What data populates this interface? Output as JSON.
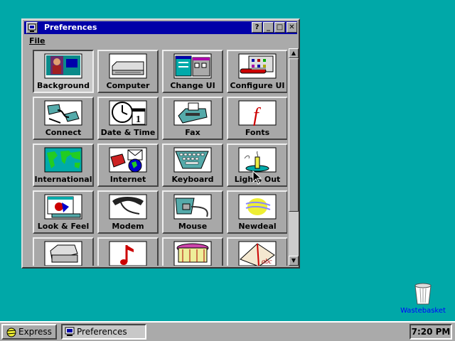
{
  "window": {
    "title": "Preferences",
    "controls": {
      "help": "?",
      "minimize": "_",
      "maximize": "□",
      "close": "✕"
    },
    "menu": {
      "file": "File"
    }
  },
  "tiles": [
    {
      "label": "Background",
      "icon": "background-icon"
    },
    {
      "label": "Computer",
      "icon": "computer-icon"
    },
    {
      "label": "Change UI",
      "icon": "change-ui-icon"
    },
    {
      "label": "Configure UI",
      "icon": "configure-ui-icon"
    },
    {
      "label": "Connect",
      "icon": "connect-icon"
    },
    {
      "label": "Date & Time",
      "icon": "date-time-icon"
    },
    {
      "label": "Fax",
      "icon": "fax-icon"
    },
    {
      "label": "Fonts",
      "icon": "fonts-icon"
    },
    {
      "label": "International",
      "icon": "world-map-icon"
    },
    {
      "label": "Internet",
      "icon": "internet-icon"
    },
    {
      "label": "Keyboard",
      "icon": "keyboard-icon"
    },
    {
      "label": "Lights Out",
      "icon": "candle-icon"
    },
    {
      "label": "Look & Feel",
      "icon": "look-feel-icon"
    },
    {
      "label": "Modem",
      "icon": "phone-icon"
    },
    {
      "label": "Mouse",
      "icon": "mouse-icon"
    },
    {
      "label": "Newdeal",
      "icon": "newdeal-icon"
    },
    {
      "label": "",
      "icon": "printer-icon"
    },
    {
      "label": "",
      "icon": "music-note-icon"
    },
    {
      "label": "",
      "icon": "carousel-icon"
    },
    {
      "label": "",
      "icon": "book-abc-icon"
    }
  ],
  "desktop": {
    "wastebasket": "Wastebasket"
  },
  "taskbar": {
    "express": "Express",
    "task": "Preferences",
    "clock": "7:20 PM"
  },
  "colors": {
    "desktop": "#00a8a8",
    "titlebar": "#0000a8",
    "chrome": "#aaaaaa"
  }
}
